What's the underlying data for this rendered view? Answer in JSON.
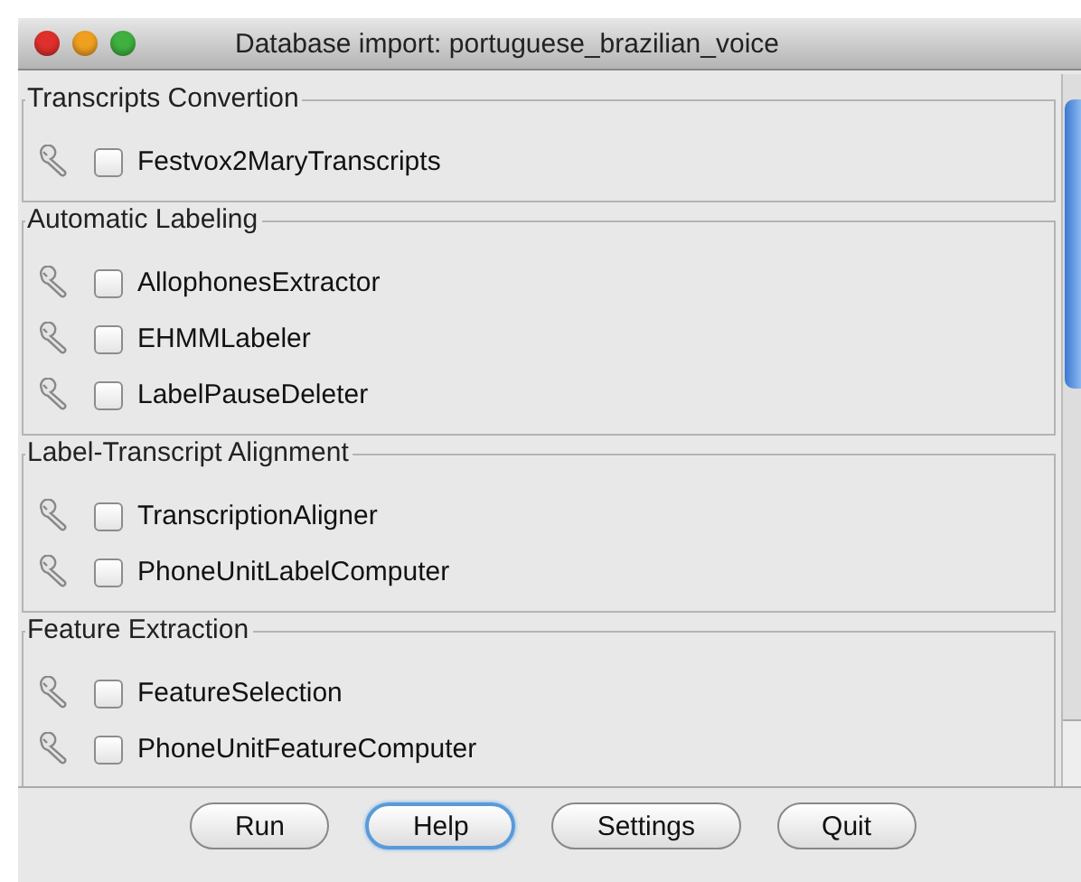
{
  "window": {
    "title": "Database import: portuguese_brazilian_voice"
  },
  "groups": [
    {
      "title": "Transcripts Convertion",
      "items": [
        {
          "label": "Festvox2MaryTranscripts",
          "checked": false
        }
      ]
    },
    {
      "title": "Automatic Labeling",
      "items": [
        {
          "label": "AllophonesExtractor",
          "checked": false
        },
        {
          "label": "EHMMLabeler",
          "checked": false
        },
        {
          "label": "LabelPauseDeleter",
          "checked": false
        }
      ]
    },
    {
      "title": "Label-Transcript Alignment",
      "items": [
        {
          "label": "TranscriptionAligner",
          "checked": false
        },
        {
          "label": "PhoneUnitLabelComputer",
          "checked": false
        }
      ]
    },
    {
      "title": "Feature Extraction",
      "items": [
        {
          "label": "FeatureSelection",
          "checked": false
        },
        {
          "label": "PhoneUnitFeatureComputer",
          "checked": false
        }
      ]
    }
  ],
  "buttons": [
    {
      "label": "Run",
      "default": false
    },
    {
      "label": "Help",
      "default": true
    },
    {
      "label": "Settings",
      "default": false
    },
    {
      "label": "Quit",
      "default": false
    }
  ]
}
